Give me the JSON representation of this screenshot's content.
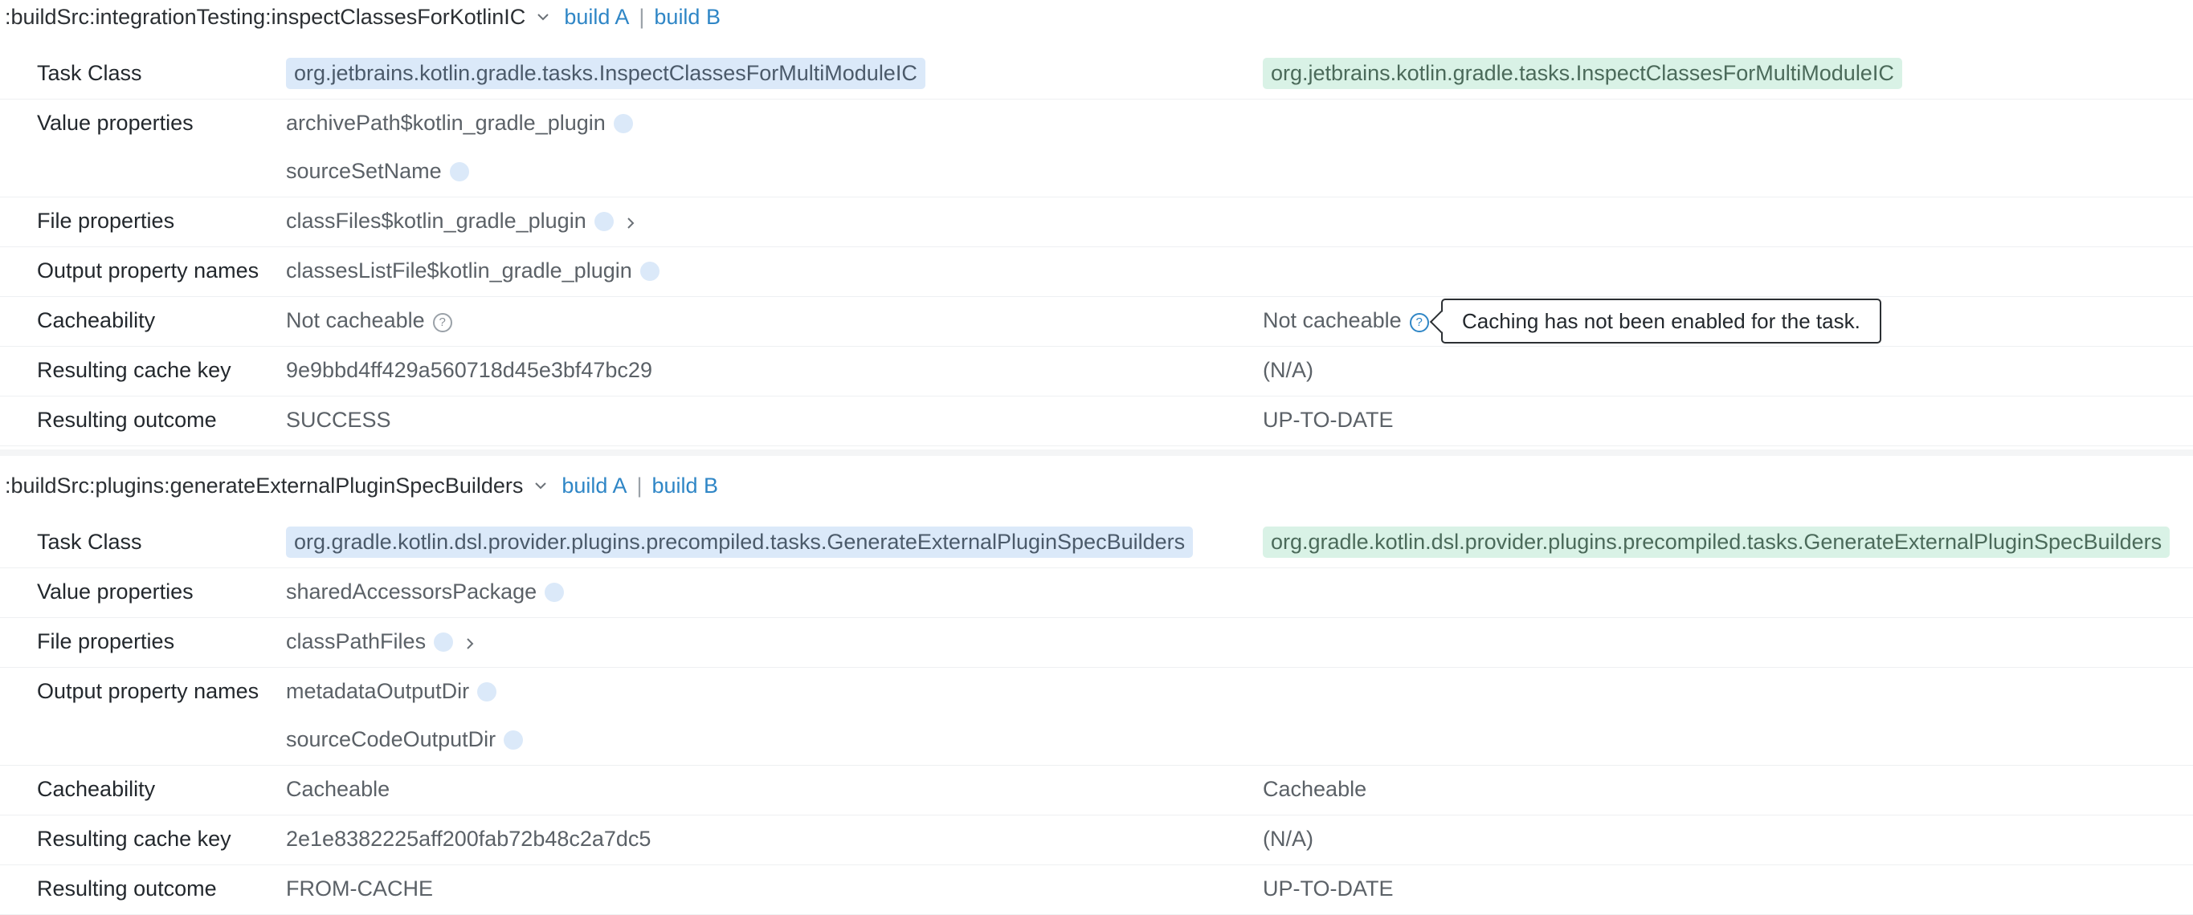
{
  "sections": [
    {
      "task_path": ":buildSrc:integrationTesting:inspectClassesForKotlinIC",
      "link_a": "build A",
      "link_sep": "|",
      "link_b": "build B",
      "task_class_label": "Task Class",
      "task_class_a": "org.jetbrains.kotlin.gradle.tasks.InspectClassesForMultiModuleIC",
      "task_class_b": "org.jetbrains.kotlin.gradle.tasks.InspectClassesForMultiModuleIC",
      "value_props_label": "Value properties",
      "value_props": [
        "archivePath$kotlin_gradle_plugin",
        "sourceSetName"
      ],
      "file_props_label": "File properties",
      "file_props": [
        "classFiles$kotlin_gradle_plugin"
      ],
      "output_props_label": "Output property names",
      "output_props": [
        "classesListFile$kotlin_gradle_plugin"
      ],
      "cacheability_label": "Cacheability",
      "cacheability_a": "Not cacheable",
      "cacheability_b": "Not cacheable",
      "cache_key_label": "Resulting cache key",
      "cache_key_a": "9e9bbd4ff429a560718d45e3bf47bc29",
      "cache_key_b": "(N/A)",
      "outcome_label": "Resulting outcome",
      "outcome_a": "SUCCESS",
      "outcome_b": "UP-TO-DATE"
    },
    {
      "task_path": ":buildSrc:plugins:generateExternalPluginSpecBuilders",
      "link_a": "build A",
      "link_sep": "|",
      "link_b": "build B",
      "task_class_label": "Task Class",
      "task_class_a": "org.gradle.kotlin.dsl.provider.plugins.precompiled.tasks.GenerateExternalPluginSpecBuilders",
      "task_class_b": "org.gradle.kotlin.dsl.provider.plugins.precompiled.tasks.GenerateExternalPluginSpecBuilders",
      "value_props_label": "Value properties",
      "value_props": [
        "sharedAccessorsPackage"
      ],
      "file_props_label": "File properties",
      "file_props": [
        "classPathFiles"
      ],
      "output_props_label": "Output property names",
      "output_props": [
        "metadataOutputDir",
        "sourceCodeOutputDir"
      ],
      "cacheability_label": "Cacheability",
      "cacheability_a": "Cacheable",
      "cacheability_b": "Cacheable",
      "cache_key_label": "Resulting cache key",
      "cache_key_a": "2e1e8382225aff200fab72b48c2a7dc5",
      "cache_key_b": "(N/A)",
      "outcome_label": "Resulting outcome",
      "outcome_a": "FROM-CACHE",
      "outcome_b": "UP-TO-DATE"
    }
  ],
  "tooltip": {
    "text": "Caching has not been enabled for the task."
  },
  "help_glyph": "?",
  "colors": {
    "link": "#2f86c6",
    "chip_a": "#dbe9f9",
    "chip_b": "#d9f2e6"
  },
  "icons": [
    "chevron-down-icon",
    "chevron-right-icon",
    "info-dot-icon",
    "question-circle-icon"
  ]
}
